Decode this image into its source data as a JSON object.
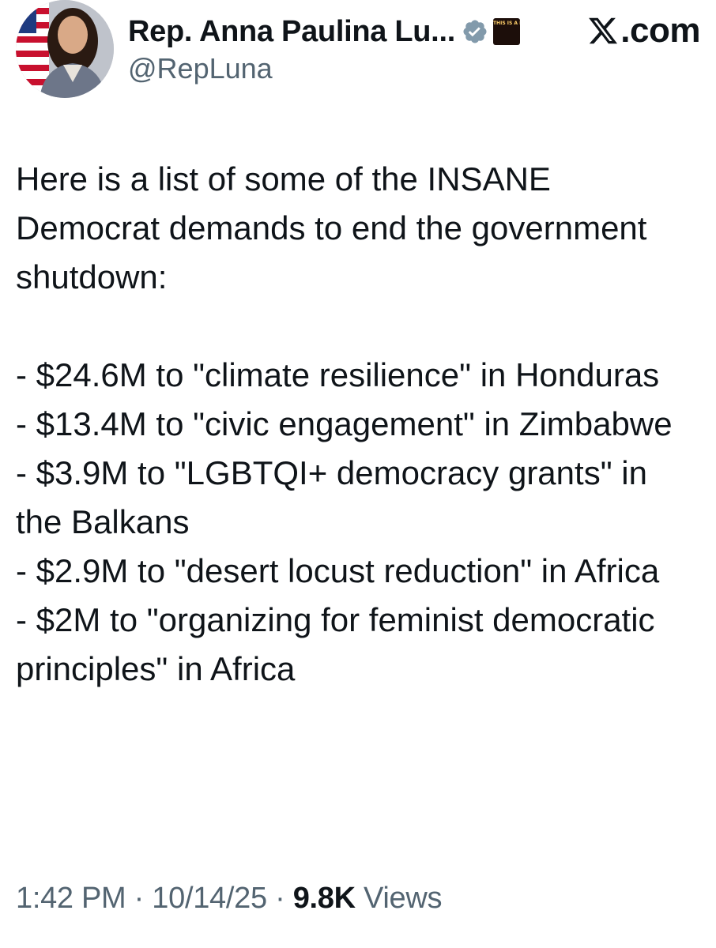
{
  "author": {
    "display_name": "Rep. Anna Paulina Lu...",
    "handle": "@RepLuna",
    "verified_icon": "verified-badge-icon",
    "affiliate_badge_text": "THIS IS A DEMOCRAT SHUTDOWN"
  },
  "brand": {
    "logo_text": ".com"
  },
  "tweet": {
    "intro": "Here is a list of some of the INSANE Democrat demands to end the government shutdown:",
    "items": [
      "- $24.6M to \"climate resilience\" in Honduras",
      "- $13.4M to \"civic engagement\" in Zimbabwe",
      "- $3.9M to \"LGBTQI+ democracy grants\" in the Balkans",
      "- $2.9M to \"desert locust reduction\" in Africa",
      "- $2M to \"organizing for feminist democratic principles\" in Africa"
    ]
  },
  "meta": {
    "time": "1:42 PM",
    "date": "10/14/25",
    "separator": " · ",
    "views_count": "9.8K",
    "views_label": "Views"
  },
  "colors": {
    "text_primary": "#0f1419",
    "text_secondary": "#536471",
    "verified_badge": "#829aab"
  }
}
